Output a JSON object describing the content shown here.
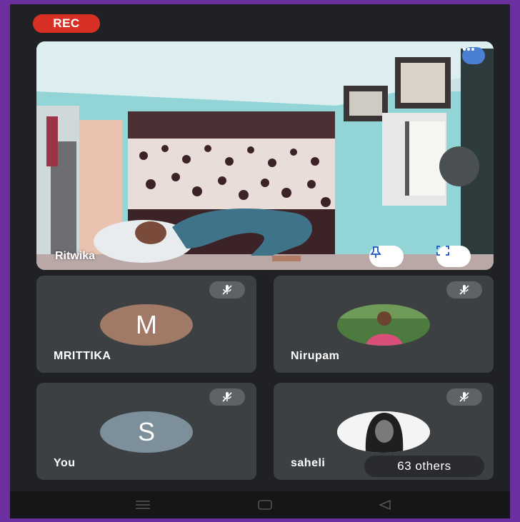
{
  "recording": {
    "label": "REC",
    "color": "#d93025"
  },
  "main_video": {
    "participant_name": "Ritwika",
    "pin_icon": "pin-icon",
    "fullscreen_icon": "fullscreen-icon",
    "more_icon": "more-options-icon"
  },
  "participants": [
    {
      "name": "MRITTIKA",
      "avatar_initial": "M",
      "avatar_color": "#a07a66",
      "muted": true
    },
    {
      "name": "Nirupam",
      "avatar_type": "photo",
      "muted": true
    },
    {
      "name": "You",
      "avatar_initial": "S",
      "avatar_color": "#7d8f9a",
      "muted": true
    },
    {
      "name": "saheli",
      "avatar_type": "photo",
      "muted": true
    }
  ],
  "others_count_label": "63 others",
  "nav_bar": {
    "icons": [
      "recents-icon",
      "home-icon",
      "back-icon"
    ]
  }
}
